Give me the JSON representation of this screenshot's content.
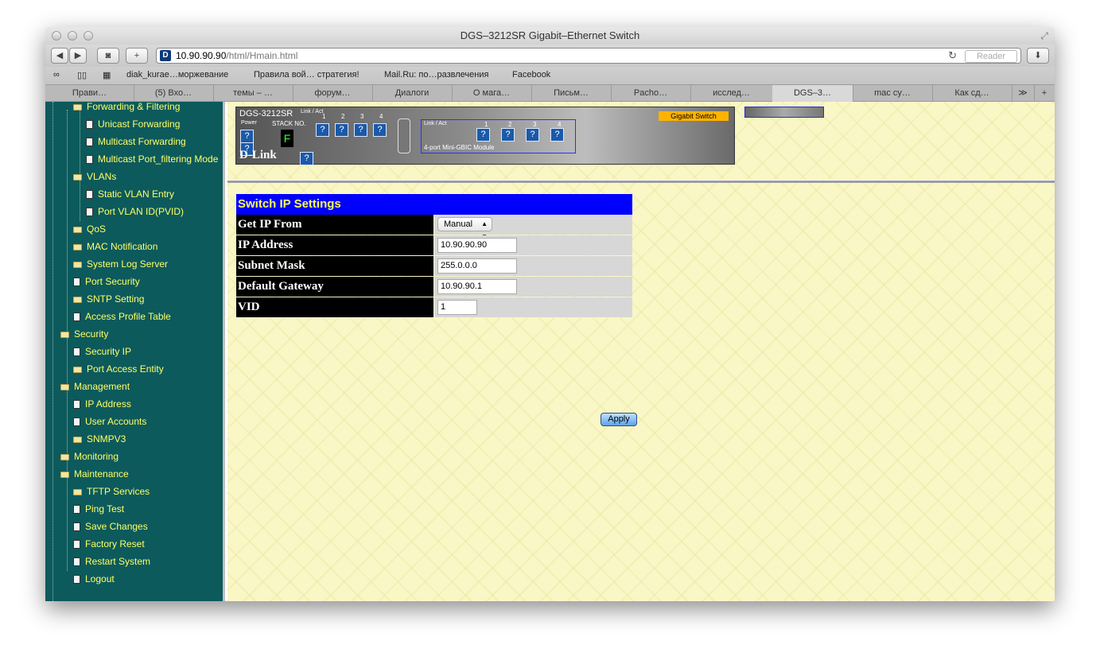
{
  "window": {
    "title": "DGS–3212SR Gigabit–Ethernet Switch",
    "url_host": "10.90.90.90",
    "url_path": "/html/Hmain.html",
    "reader_label": "Reader"
  },
  "bookmarks": [
    "diak_kurae…моржевание",
    "Правила вой… стратегия!",
    "Mail.Ru: по…развлечения",
    "Facebook"
  ],
  "tabs": [
    "Прави…",
    "(5) Вхо…",
    "темы – …",
    "форум…",
    "Диалоги",
    "О мага…",
    "Письм…",
    "Pacho…",
    "исслед…",
    "DGS–3…",
    "mac су…",
    "Как сд…"
  ],
  "active_tab": 9,
  "sidebar": {
    "items": [
      {
        "label": "Forwarding & Filtering",
        "icon": "folder-open-icon"
      },
      {
        "label": "Unicast Forwarding",
        "icon": "page-icon"
      },
      {
        "label": "Multicast Forwarding",
        "icon": "page-icon"
      },
      {
        "label": "Multicast Port_filtering Mode",
        "icon": "page-icon"
      },
      {
        "label": "VLANs",
        "icon": "folder-open-icon"
      },
      {
        "label": "Static VLAN Entry",
        "icon": "page-icon"
      },
      {
        "label": "Port VLAN ID(PVID)",
        "icon": "page-icon"
      },
      {
        "label": "QoS",
        "icon": "folder-icon"
      },
      {
        "label": "MAC Notification",
        "icon": "folder-icon"
      },
      {
        "label": "System Log Server",
        "icon": "folder-icon"
      },
      {
        "label": "Port Security",
        "icon": "page-icon"
      },
      {
        "label": "SNTP Setting",
        "icon": "folder-icon"
      },
      {
        "label": "Access Profile Table",
        "icon": "page-icon"
      },
      {
        "label": "Security",
        "icon": "folder-open-icon"
      },
      {
        "label": "Security IP",
        "icon": "page-icon"
      },
      {
        "label": "Port Access Entity",
        "icon": "folder-icon"
      },
      {
        "label": "Management",
        "icon": "folder-open-icon"
      },
      {
        "label": "IP Address",
        "icon": "page-icon"
      },
      {
        "label": "User Accounts",
        "icon": "page-icon"
      },
      {
        "label": "SNMPV3",
        "icon": "folder-icon"
      },
      {
        "label": "Monitoring",
        "icon": "folder-icon"
      },
      {
        "label": "Maintenance",
        "icon": "folder-open-icon"
      },
      {
        "label": "TFTP Services",
        "icon": "folder-icon"
      },
      {
        "label": "Ping Test",
        "icon": "page-icon"
      },
      {
        "label": "Save Changes",
        "icon": "page-icon"
      },
      {
        "label": "Factory Reset",
        "icon": "page-icon"
      },
      {
        "label": "Restart System",
        "icon": "page-icon"
      },
      {
        "label": "Logout",
        "icon": "page-icon"
      }
    ]
  },
  "device": {
    "model": "DGS-3212SR",
    "brand": "D-Link",
    "gigabit_label": "Gigabit Switch",
    "stack_label": "STACK NO.",
    "stack_digit": "F",
    "power_label": "Power",
    "link_act_label": "Link / Act",
    "module_label": "4-port Mini-GBIC Module",
    "port_numbers": [
      "1",
      "2",
      "3",
      "4"
    ],
    "sfp_numbers": [
      "1",
      "2",
      "3",
      "4"
    ]
  },
  "form": {
    "title": "Switch IP Settings",
    "get_ip_label": "Get IP From",
    "get_ip_value": "Manual",
    "ip_label": "IP Address",
    "ip_value": "10.90.90.90",
    "subnet_label": "Subnet Mask",
    "subnet_value": "255.0.0.0",
    "gateway_label": "Default Gateway",
    "gateway_value": "10.90.90.1",
    "vid_label": "VID",
    "vid_value": "1",
    "apply_label": "Apply"
  }
}
